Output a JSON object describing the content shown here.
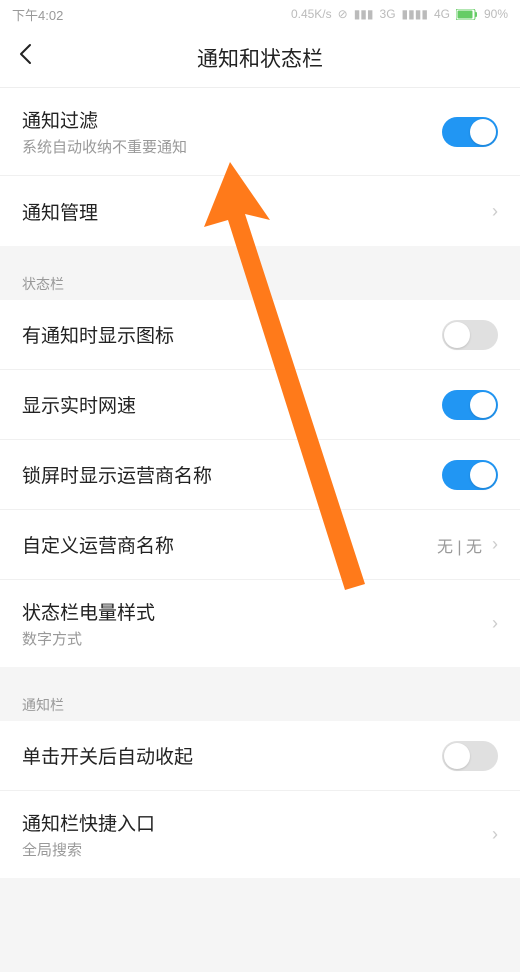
{
  "statusBar": {
    "time": "下午4:02",
    "speed": "0.45K/s",
    "net1": "3G",
    "net2": "4G",
    "battery": "90%"
  },
  "header": {
    "title": "通知和状态栏"
  },
  "section1": {
    "rows": [
      {
        "title": "通知过滤",
        "subtitle": "系统自动收纳不重要通知",
        "toggle": true,
        "on": true
      },
      {
        "title": "通知管理",
        "chevron": true
      }
    ]
  },
  "section2": {
    "header": "状态栏",
    "rows": [
      {
        "title": "有通知时显示图标",
        "toggle": true,
        "on": false
      },
      {
        "title": "显示实时网速",
        "toggle": true,
        "on": true
      },
      {
        "title": "锁屏时显示运营商名称",
        "toggle": true,
        "on": true
      },
      {
        "title": "自定义运营商名称",
        "value": "无 | 无",
        "chevron": true
      },
      {
        "title": "状态栏电量样式",
        "subtitle": "数字方式",
        "chevron": true
      }
    ]
  },
  "section3": {
    "header": "通知栏",
    "rows": [
      {
        "title": "单击开关后自动收起",
        "toggle": true,
        "on": false
      },
      {
        "title": "通知栏快捷入口",
        "subtitle": "全局搜索",
        "chevron": true
      }
    ]
  }
}
